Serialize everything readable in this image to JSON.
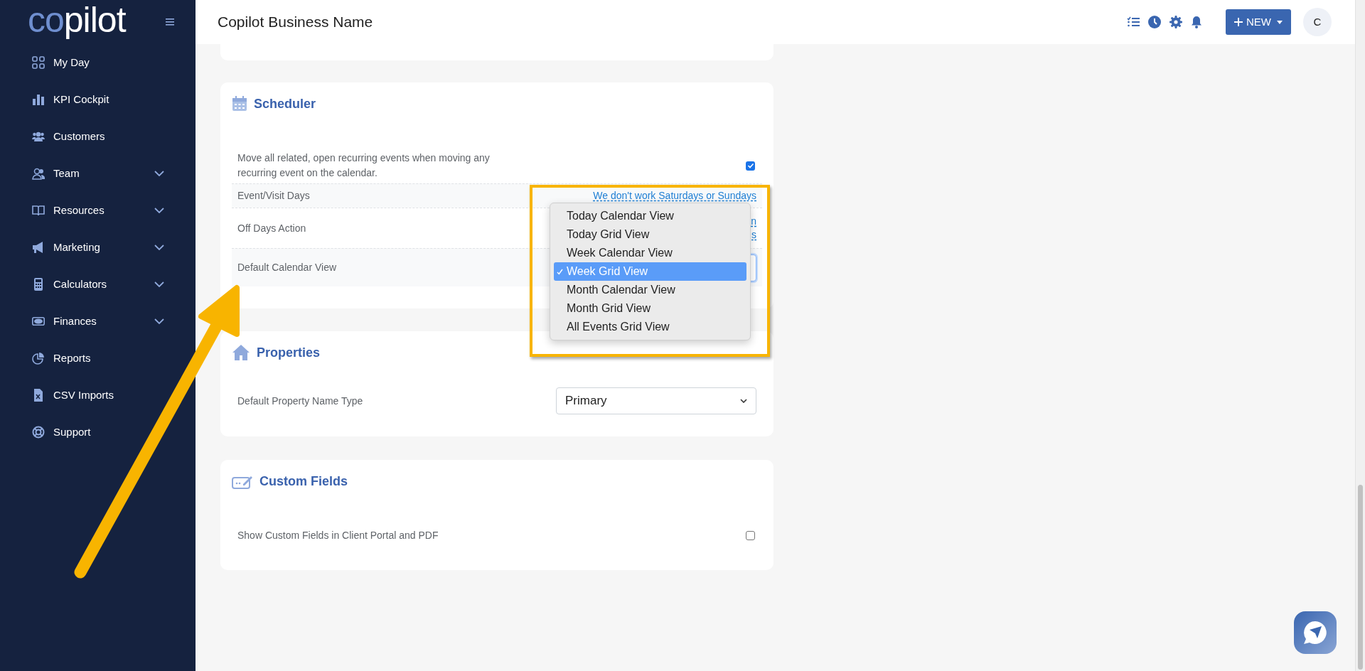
{
  "sidebar": {
    "logo": {
      "part_1": "co",
      "part_2": "pilot"
    },
    "items": [
      {
        "label": "My Day",
        "has_submenu": false
      },
      {
        "label": "KPI Cockpit",
        "has_submenu": false
      },
      {
        "label": "Customers",
        "has_submenu": false
      },
      {
        "label": "Team",
        "has_submenu": true
      },
      {
        "label": "Resources",
        "has_submenu": true
      },
      {
        "label": "Marketing",
        "has_submenu": true
      },
      {
        "label": "Calculators",
        "has_submenu": true
      },
      {
        "label": "Finances",
        "has_submenu": true
      },
      {
        "label": "Reports",
        "has_submenu": false
      },
      {
        "label": "CSV Imports",
        "has_submenu": false
      },
      {
        "label": "Support",
        "has_submenu": false
      }
    ]
  },
  "topbar": {
    "title": "Copilot Business Name",
    "new_button": "NEW",
    "avatar": "C"
  },
  "scheduler": {
    "title": "Scheduler",
    "rows": [
      {
        "kind": "checkbox",
        "label": "Move all related, open recurring events when moving any recurring event on the calendar.",
        "checked": true
      },
      {
        "kind": "link",
        "label": "Event/Visit Days",
        "lines": [
          "We don't work Saturdays or Sundays"
        ]
      },
      {
        "kind": "link",
        "label": "Off Days Action",
        "lines": [
          "n",
          "s"
        ]
      },
      {
        "kind": "select",
        "label": "Default Calendar View"
      }
    ],
    "dropdown": {
      "options": [
        {
          "label": "Today Calendar View",
          "selected": false
        },
        {
          "label": "Today Grid View",
          "selected": false
        },
        {
          "label": "Week Calendar View",
          "selected": false
        },
        {
          "label": "Week Grid View",
          "selected": true
        },
        {
          "label": "Month Calendar View",
          "selected": false
        },
        {
          "label": "Month Grid View",
          "selected": false
        },
        {
          "label": "All Events Grid View",
          "selected": false
        }
      ]
    }
  },
  "properties": {
    "title": "Properties",
    "rows": [
      {
        "kind": "select",
        "label": "Default Property Name Type",
        "value": "Primary"
      }
    ]
  },
  "custom_fields": {
    "title": "Custom Fields",
    "rows": [
      {
        "kind": "checkbox",
        "label": "Show Custom Fields in Client Portal and PDF",
        "checked": false
      }
    ]
  }
}
